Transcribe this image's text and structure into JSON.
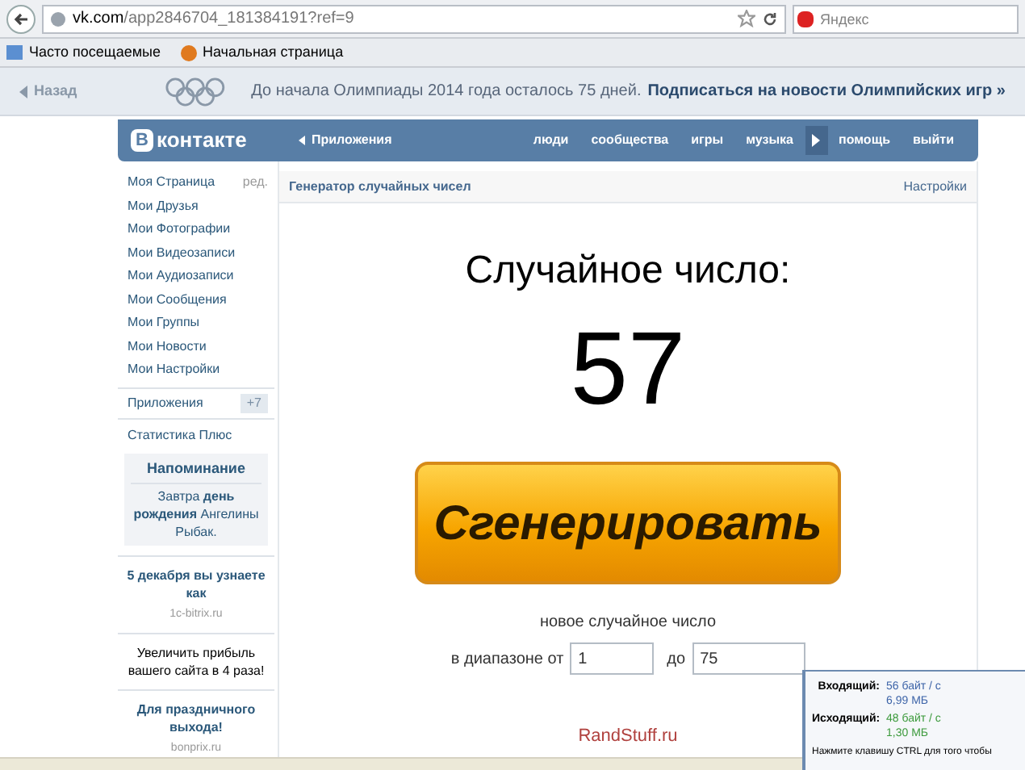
{
  "browser": {
    "url_host": "vk.com",
    "url_path": "/app2846704_181384191?ref=9",
    "search_placeholder": "Яндекс",
    "bookmarks": [
      "Часто посещаемые",
      "Начальная страница"
    ]
  },
  "banner": {
    "back": "Назад",
    "text": "До начала Олимпиады 2014 года осталось 75 дней.",
    "link": "Подписаться на новости Олимпийских игр »"
  },
  "header": {
    "logo_letter": "В",
    "logo_text": "контакте",
    "apps": "Приложения",
    "nav": [
      "люди",
      "сообщества",
      "игры",
      "музыка",
      "помощь",
      "выйти"
    ]
  },
  "sidebar": {
    "items": [
      {
        "label": "Моя Страница",
        "extra": "ред."
      },
      {
        "label": "Мои Друзья"
      },
      {
        "label": "Мои Фотографии"
      },
      {
        "label": "Мои Видеозаписи"
      },
      {
        "label": "Мои Аудиозаписи"
      },
      {
        "label": "Мои Сообщения"
      },
      {
        "label": "Мои Группы"
      },
      {
        "label": "Мои Новости"
      },
      {
        "label": "Мои Настройки"
      }
    ],
    "apps": {
      "label": "Приложения",
      "badge": "+7"
    },
    "stats": "Статистика Плюс",
    "reminder": {
      "title": "Напоминание",
      "text": "Завтра **день рождения** Ангелины Рыбак."
    },
    "ads": [
      {
        "title": "5 декабря вы узнаете как",
        "domain": "1c-bitrix.ru"
      },
      {
        "text": "Увеличить прибыль вашего сайта в 4 раза!"
      },
      {
        "title": "Для праздничного выхода!",
        "domain": "bonprix.ru"
      }
    ]
  },
  "app": {
    "title": "Генератор случайных чисел",
    "settings": "Настройки",
    "heading": "Случайное число:",
    "number": "57",
    "button": "Сгенерировать",
    "caption": "новое случайное число",
    "range_label": "в диапазоне от",
    "from": "1",
    "to_label": "до",
    "to": "75",
    "footer": "RandStuff.ru"
  },
  "traffic": {
    "in_label": "Входящий:",
    "in_rate": "56 байт / с",
    "in_total": "6,99 МБ",
    "out_label": "Исходящий:",
    "out_rate": "48 байт / с",
    "out_total": "1,30 МБ",
    "hint": "Нажмите клавишу CTRL для того чтобы"
  }
}
